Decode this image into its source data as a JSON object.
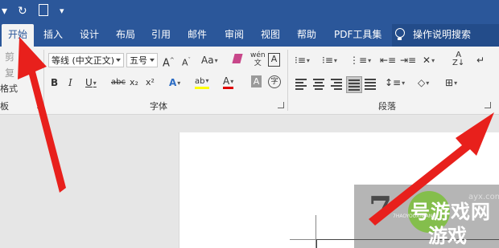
{
  "quick_access": {
    "redo_glyph": "↻",
    "print_preview_glyph": "🔍"
  },
  "tabs": [
    {
      "label": "开始",
      "active": true
    },
    {
      "label": "插入"
    },
    {
      "label": "设计"
    },
    {
      "label": "布局"
    },
    {
      "label": "引用"
    },
    {
      "label": "邮件"
    },
    {
      "label": "审阅"
    },
    {
      "label": "视图"
    },
    {
      "label": "帮助"
    },
    {
      "label": "PDF工具集"
    }
  ],
  "tell_me": {
    "label": "操作说明搜索",
    "icon": "lightbulb-icon"
  },
  "clipboard": {
    "cut_partial": "剪",
    "copy_partial": "复",
    "format_painter_partial": "格式",
    "group_label_partial": "板"
  },
  "font": {
    "font_name": "等线 (中文正文)",
    "font_size": "五号",
    "grow_label": "A",
    "shrink_label": "A",
    "case_label": "Aa",
    "phonetic_label": "wén",
    "bold": "B",
    "italic": "I",
    "underline": "U",
    "strikethrough": "abc",
    "subscript": "x₂",
    "superscript": "x²",
    "text_effect": "A",
    "highlight": "ab",
    "font_color": "A",
    "char_shading": "A",
    "enclosed_char": "字",
    "group_label": "字体",
    "font_color_hex": "#e00000",
    "highlight_hex": "#ffff00"
  },
  "paragraph": {
    "group_label": "段落"
  },
  "watermark": {
    "number": "7",
    "brand_line1": "号游戏网",
    "brand_line2": "游戏",
    "sub": "7HAOYOUXIWANG",
    "domain": "ayx.com"
  },
  "colors": {
    "title_bar": "#2b579a",
    "ribbon_bg": "#f3f3f3",
    "arrow": "#e8201c"
  }
}
